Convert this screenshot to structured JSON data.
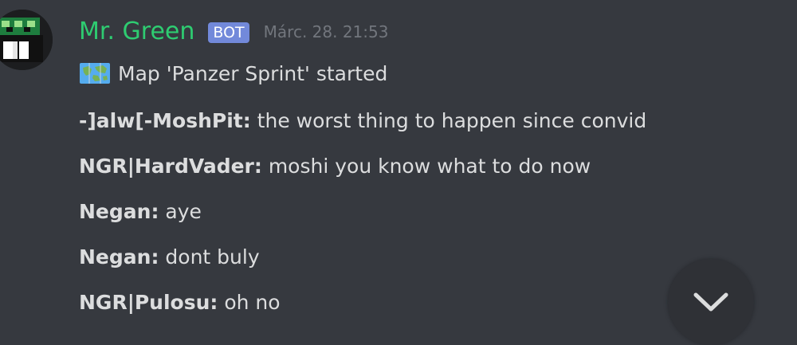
{
  "message": {
    "author": "Mr. Green",
    "badge": "BOT",
    "timestamp": "Márc. 28. 21:53",
    "map_icon": "world-map-icon",
    "map_text": "Map 'Panzer Sprint' started"
  },
  "chat_lines": [
    {
      "player": "-]alw[-MoshPit:",
      "text": " the worst thing to happen since convid"
    },
    {
      "player": "NGR|HardVader:",
      "text": " moshi you know what to do now"
    },
    {
      "player": "Negan:",
      "text": " aye"
    },
    {
      "player": "Negan:",
      "text": " dont buly"
    },
    {
      "player": "NGR|Pulosu:",
      "text": " oh no"
    }
  ],
  "scroll_button": {
    "icon": "chevron-down-icon"
  },
  "colors": {
    "background": "#36393f",
    "username": "#2ecc71",
    "badge": "#7289da",
    "timestamp": "#72767d",
    "text": "#dcddde"
  }
}
